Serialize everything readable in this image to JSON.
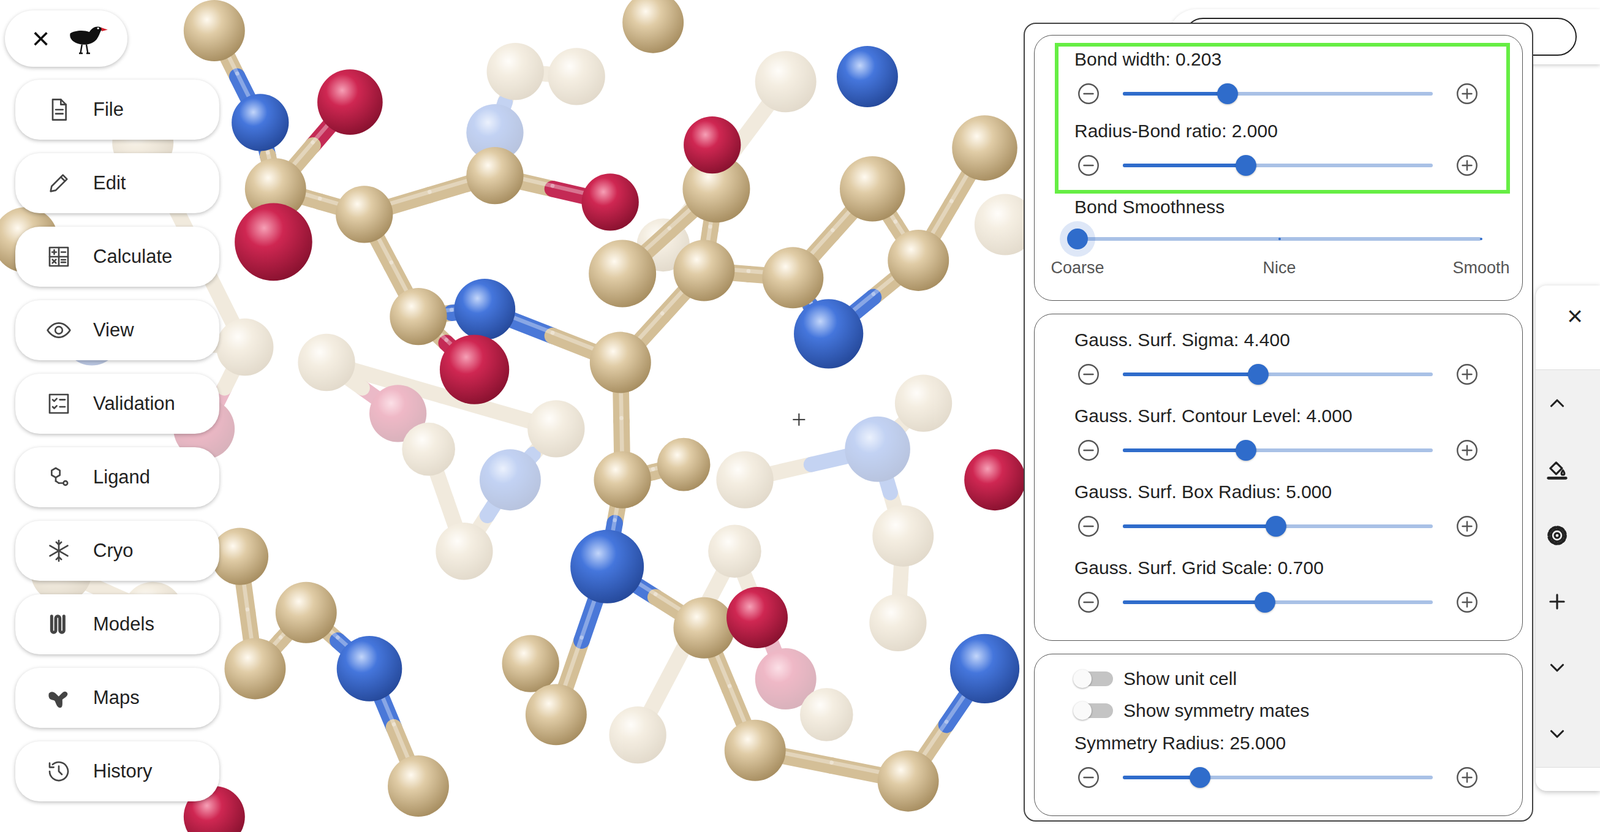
{
  "logo": {
    "close": "×"
  },
  "menu": [
    {
      "label": "File"
    },
    {
      "label": "Edit"
    },
    {
      "label": "Calculate"
    },
    {
      "label": "View"
    },
    {
      "label": "Validation"
    },
    {
      "label": "Ligand"
    },
    {
      "label": "Cryo"
    },
    {
      "label": "Models"
    },
    {
      "label": "Maps"
    },
    {
      "label": "History"
    }
  ],
  "search": {
    "value": ""
  },
  "side_panel": {
    "close": "×"
  },
  "settings": {
    "cards": [
      {
        "blocks": [
          {
            "highlighted": true,
            "items": [
              {
                "kind": "slider",
                "label": "Bond width: 0.203",
                "level": 0.338
              },
              {
                "kind": "slider",
                "label": "Radius-Bond ratio: 2.000",
                "level": 0.397
              }
            ]
          },
          {
            "highlighted": false,
            "items": [
              {
                "kind": "marks",
                "label": "Bond Smoothness",
                "level": 0,
                "marks": [
                  "Coarse",
                  "Nice",
                  "Smooth"
                ]
              }
            ]
          }
        ]
      },
      {
        "blocks": [
          {
            "highlighted": false,
            "items": [
              {
                "kind": "slider",
                "label": "Gauss. Surf. Sigma: 4.400",
                "level": 0.436
              },
              {
                "kind": "slider",
                "label": "Gauss. Surf. Contour Level: 4.000",
                "level": 0.397
              },
              {
                "kind": "slider",
                "label": "Gauss. Surf. Box Radius: 5.000",
                "level": 0.495
              },
              {
                "kind": "slider",
                "label": "Gauss. Surf. Grid Scale: 0.700",
                "level": 0.459
              }
            ]
          }
        ]
      },
      {
        "blocks": [
          {
            "highlighted": false,
            "items": [
              {
                "kind": "toggle",
                "label": "Show unit cell",
                "on": false
              },
              {
                "kind": "toggle",
                "label": "Show symmetry mates",
                "on": false
              },
              {
                "kind": "slider",
                "label": "Symmetry Radius: 25.000",
                "level": 0.249
              }
            ]
          }
        ]
      }
    ]
  }
}
